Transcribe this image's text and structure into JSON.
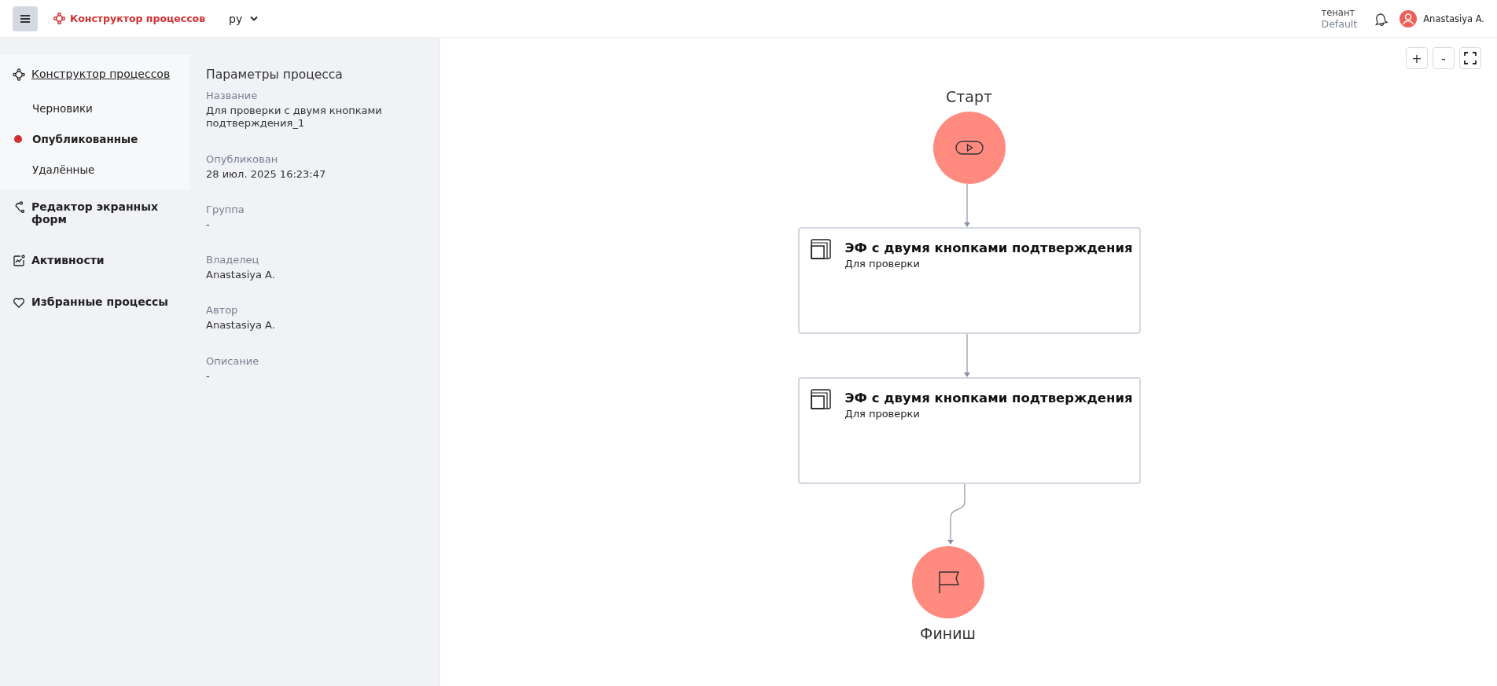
{
  "top_bar": {
    "app_title": "Конструктор процессов",
    "language": "ру",
    "tenant_label": "тенант",
    "tenant_value": "Default",
    "user_name": "Anastasiya A."
  },
  "sidebar": {
    "items": [
      {
        "kind": "process",
        "label": "Конструктор процессов",
        "selected": true,
        "children": [
          {
            "label": "Черновики",
            "selected": false
          },
          {
            "label": "Опубликованные",
            "selected": true
          },
          {
            "label": "Удалённые",
            "selected": false
          }
        ]
      },
      {
        "kind": "forms",
        "label": "Редактор экранных форм",
        "selected": false
      },
      {
        "kind": "activity",
        "label": "Активности",
        "selected": false
      },
      {
        "kind": "favorite",
        "label": "Избранные процессы",
        "selected": false
      }
    ]
  },
  "details": {
    "title": "Параметры процесса",
    "fields": [
      {
        "label": "Название",
        "value": "Для проверки с двумя кнопками подтверждения_1"
      },
      {
        "label": "Опубликован",
        "value": "28 июл. 2025 16:23:47"
      },
      {
        "label": "Группа",
        "value": "-"
      },
      {
        "label": "Владелец",
        "value": "Anastasiya A."
      },
      {
        "label": "Автор",
        "value": "Anastasiya A."
      },
      {
        "label": "Описание",
        "value": "-"
      }
    ]
  },
  "canvas": {
    "zoom_in": "+",
    "zoom_out": "-",
    "nodes": [
      {
        "kind": "start",
        "label": "Старт"
      },
      {
        "kind": "task",
        "title": "ЭФ с двумя кнопками подтверждения",
        "subtitle": "Для проверки"
      },
      {
        "kind": "task",
        "title": "ЭФ с двумя кнопками подтверждения",
        "subtitle": "Для проверки"
      },
      {
        "kind": "finish",
        "label": "Финиш"
      }
    ]
  }
}
